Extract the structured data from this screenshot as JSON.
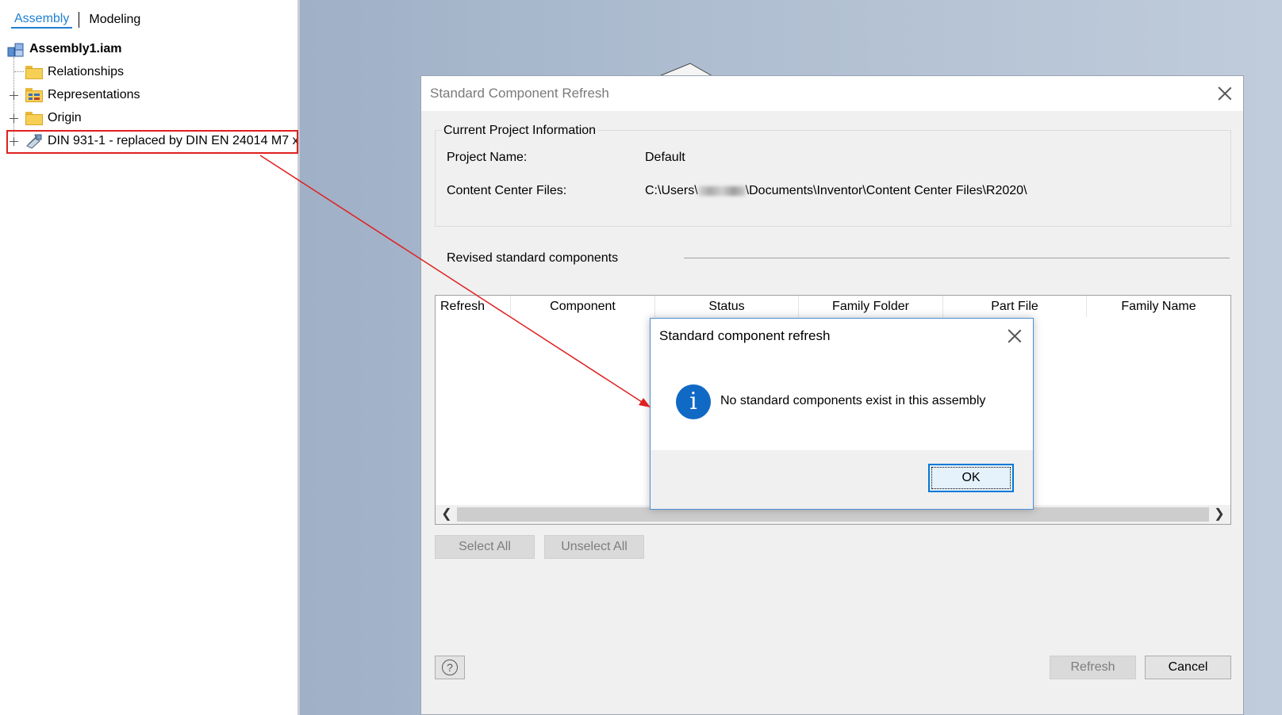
{
  "browser": {
    "tabs": [
      {
        "label": "Assembly",
        "active": true
      },
      {
        "label": "Modeling",
        "active": false
      }
    ],
    "tree": {
      "root": {
        "label": "Assembly1.iam",
        "icon": "assembly-icon"
      },
      "items": [
        {
          "label": "Relationships",
          "icon": "folder-icon",
          "expandable": false
        },
        {
          "label": "Representations",
          "icon": "representations-folder-icon",
          "expandable": true
        },
        {
          "label": "Origin",
          "icon": "folder-icon",
          "expandable": true
        },
        {
          "label": "DIN 931-1 - replaced by DIN EN 24014 M7 x",
          "icon": "part-icon",
          "expandable": true,
          "highlighted": true
        }
      ]
    }
  },
  "main_dialog": {
    "title": "Standard Component Refresh",
    "project_info": {
      "legend": "Current Project Information",
      "project_name_label": "Project Name:",
      "project_name_value": "Default",
      "content_center_label": "Content Center Files:",
      "content_center_prefix": "C:\\Users\\",
      "content_center_suffix": "\\Documents\\Inventor\\Content Center Files\\R2020\\"
    },
    "revised_label": "Revised standard components",
    "grid_columns": [
      "Refresh",
      "Component",
      "Status",
      "Family Folder",
      "Part File",
      "Family Name"
    ],
    "select_all_label": "Select All",
    "unselect_all_label": "Unselect All",
    "refresh_label": "Refresh",
    "cancel_label": "Cancel"
  },
  "message_box": {
    "title": "Standard component refresh",
    "message": "No standard components exist in this assembly",
    "ok_label": "OK",
    "icon": "info-icon"
  },
  "annotation": {
    "highlight_color": "#e02020"
  }
}
